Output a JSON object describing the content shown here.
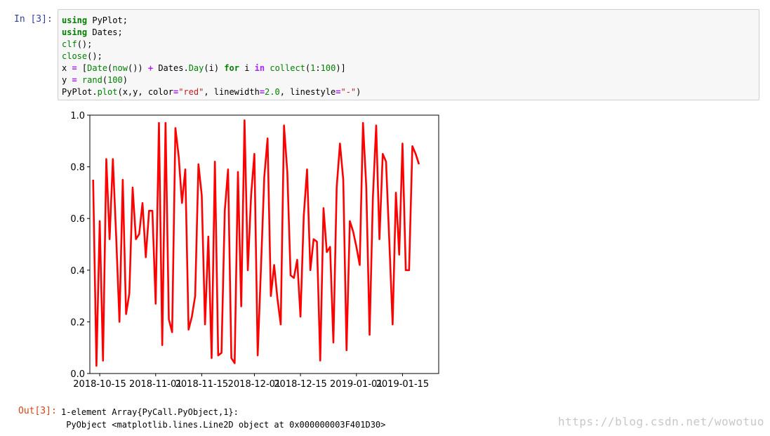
{
  "input_prompt": "In  [3]:",
  "output_prompt": "Out[3]:",
  "code_lines": [
    "using PyPlot;",
    "using Dates;",
    "clf();",
    "close();",
    "x = [Date(now()) + Dates.Day(i) for i in collect(1:100)]",
    "y = rand(100)",
    "PyPlot.plot(x,y, color=\"red\", linewidth=2.0, linestyle=\"-\")"
  ],
  "output_lines": [
    "1-element Array{PyCall.PyObject,1}:",
    " PyObject <matplotlib.lines.Line2D object at 0x000000003F401D30>"
  ],
  "watermark": "https://blog.csdn.net/wowotuo",
  "chart_data": {
    "type": "line",
    "color": "#ff0000",
    "ylim": [
      0.0,
      1.0
    ],
    "yticks": [
      "0.0",
      "0.2",
      "0.4",
      "0.6",
      "0.8",
      "1.0"
    ],
    "xtick_labels": [
      "2018-10-15",
      "2018-11-01",
      "2018-11-15",
      "2018-12-01",
      "2018-12-15",
      "2019-01-01",
      "2019-01-15"
    ],
    "xticks": [
      "2018-10-15",
      "2018-11-01",
      "2018-11-15",
      "2018-12-01",
      "2018-12-15",
      "2019-01-01",
      "2019-01-15"
    ],
    "xlim": [
      "2018-10-12",
      "2019-01-26"
    ],
    "series": [
      {
        "start": "2018-10-13",
        "values": [
          0.75,
          0.03,
          0.59,
          0.05,
          0.83,
          0.52,
          0.83,
          0.53,
          0.2,
          0.75,
          0.23,
          0.31,
          0.72,
          0.52,
          0.54,
          0.66,
          0.45,
          0.63,
          0.63,
          0.27,
          0.97,
          0.11,
          0.97,
          0.21,
          0.16,
          0.95,
          0.84,
          0.66,
          0.79,
          0.17,
          0.22,
          0.3,
          0.81,
          0.69,
          0.19,
          0.53,
          0.06,
          0.82,
          0.07,
          0.08,
          0.63,
          0.79,
          0.06,
          0.04,
          0.78,
          0.26,
          0.98,
          0.4,
          0.69,
          0.85,
          0.07,
          0.41,
          0.76,
          0.91,
          0.3,
          0.42,
          0.29,
          0.19,
          0.96,
          0.78,
          0.38,
          0.37,
          0.44,
          0.22,
          0.61,
          0.79,
          0.4,
          0.52,
          0.51,
          0.05,
          0.64,
          0.47,
          0.49,
          0.12,
          0.72,
          0.89,
          0.75,
          0.09,
          0.59,
          0.55,
          0.49,
          0.42,
          0.97,
          0.72,
          0.15,
          0.68,
          0.96,
          0.52,
          0.85,
          0.82,
          0.51,
          0.19,
          0.7,
          0.46,
          0.89,
          0.4,
          0.4,
          0.88,
          0.85,
          0.81
        ]
      }
    ]
  }
}
